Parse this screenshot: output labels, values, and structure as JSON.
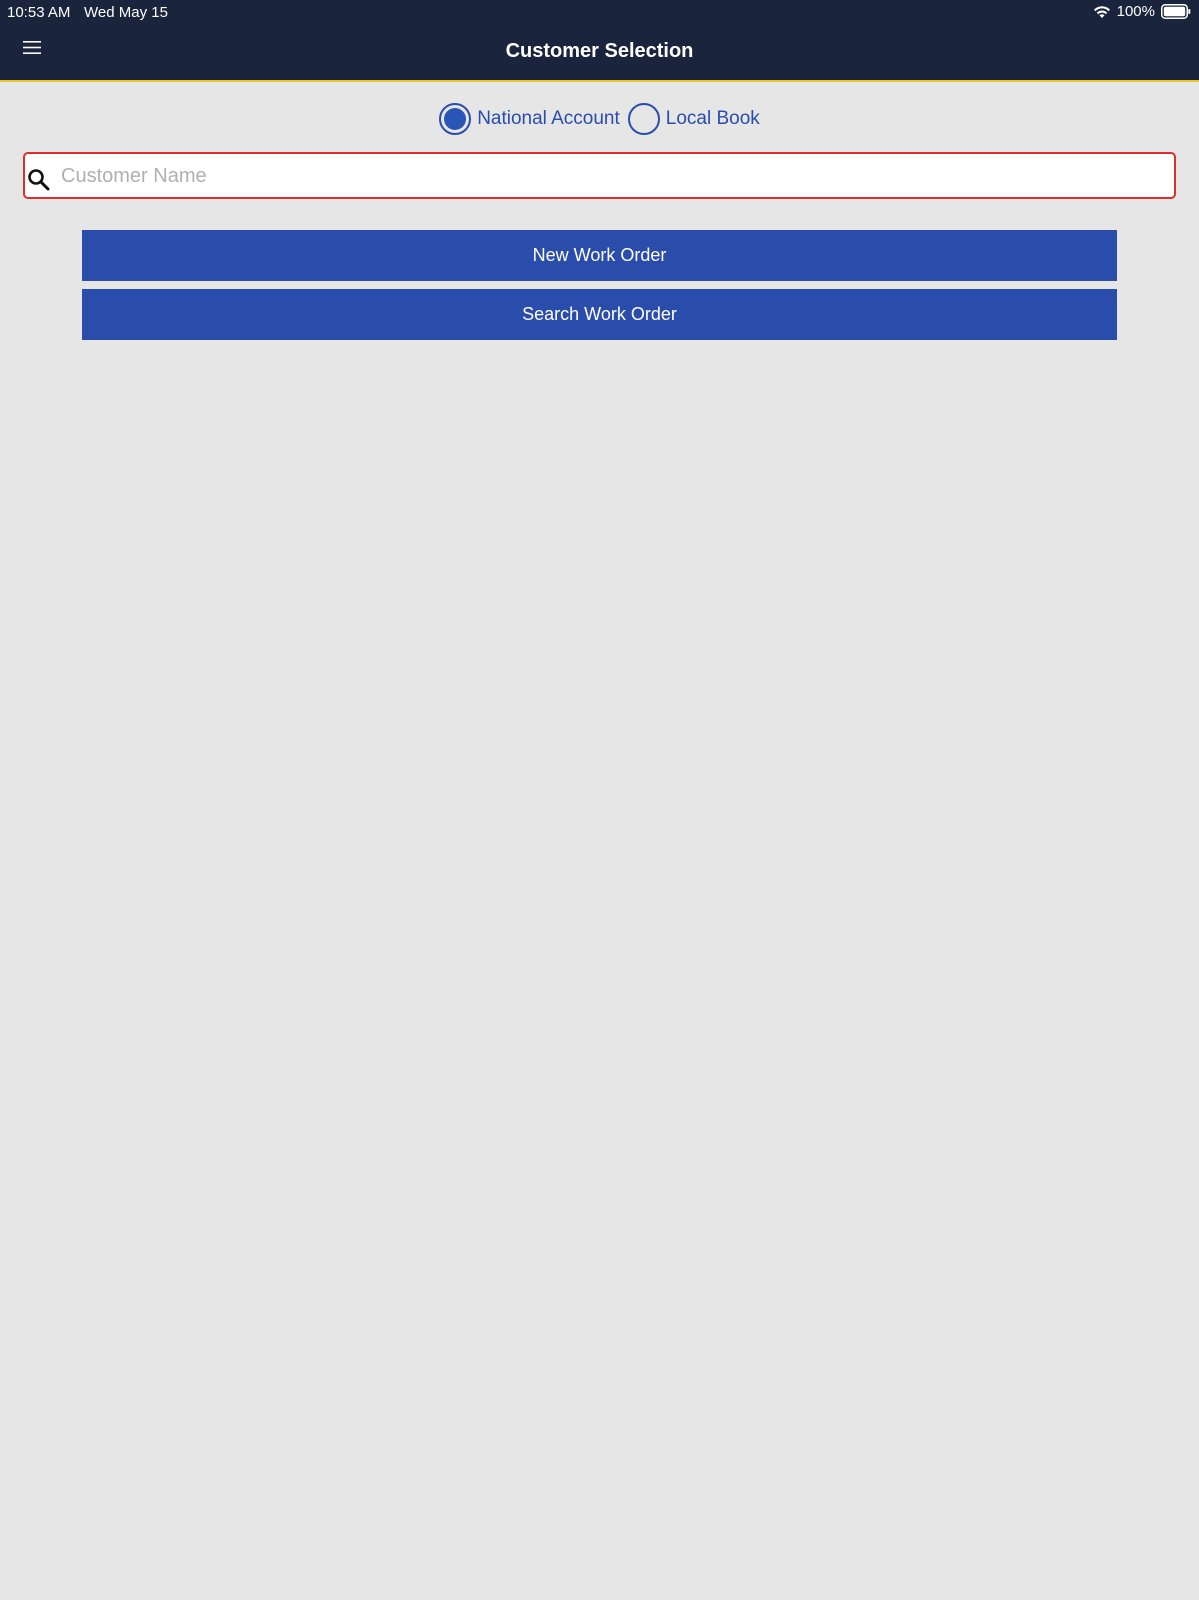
{
  "status_bar": {
    "time": "10:53 AM",
    "date": "Wed May 15",
    "battery": "100%",
    "wifi_icon": "wifi-icon",
    "battery_icon": "battery-icon"
  },
  "header": {
    "title": "Customer Selection",
    "menu_icon": "hamburger-menu-icon",
    "background": "#1a243c",
    "accent_line": "#e8c62c"
  },
  "account_type": {
    "options": [
      {
        "label": "National Account",
        "selected": true
      },
      {
        "label": "Local Book",
        "selected": false
      }
    ],
    "color": "#2a4cad"
  },
  "search": {
    "placeholder": "Customer Name",
    "value": "",
    "icon": "search-icon",
    "border_color": "#e02c2c"
  },
  "actions": {
    "new_work_order": "New Work Order",
    "search_work_order": "Search Work Order",
    "button_color": "#2a4caa"
  }
}
